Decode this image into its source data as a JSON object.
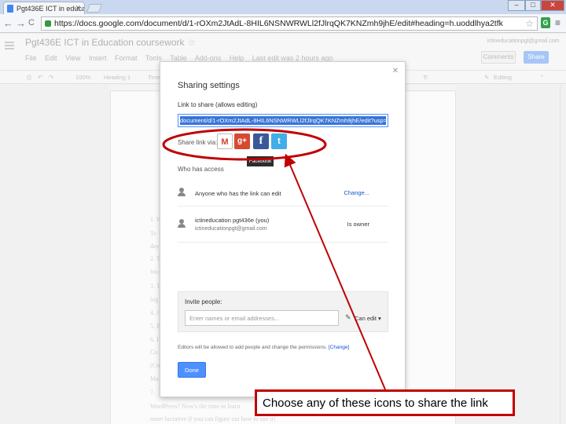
{
  "browser": {
    "tab_title": "Pgt436E ICT in education",
    "url": "https://docs.google.com/document/d/1-rOXm2JtAdL-8HIL6NSNWRWLl2fJlrqQK7KNZmh9jhE/edit#heading=h.uoddlhya2tfk",
    "win_min": "–",
    "win_max": "□",
    "win_close": "✕",
    "back": "←",
    "forward": "→",
    "reload": "C",
    "bookmark_star": "☆",
    "extension": "G",
    "menu": "≡"
  },
  "docs": {
    "title": "Pgt436E ICT in Education coursework",
    "menus": [
      "File",
      "Edit",
      "View",
      "Insert",
      "Format",
      "Tools",
      "Table",
      "Add-ons",
      "Help",
      "Last edit was 2 hours ago"
    ],
    "user_email": "ictineducationpgt@gmail.com",
    "comments_label": "Comments",
    "share_label": "Share",
    "format_bar": {
      "zoom": "100%",
      "style": "Heading 1",
      "font": "Times...",
      "mode": "Editing"
    },
    "background_lines": [
      "1. W",
      "Te",
      "day",
      "2. T",
      "Wo",
      "3. T",
      "big",
      "4. J",
      "5. B",
      "6. I",
      "Co",
      "(Cre",
      "Ma",
      "7.",
      "WordPress? Now's the time to learn",
      "more lucrative if you can figure out how to use it!"
    ]
  },
  "dialog": {
    "title": "Sharing settings",
    "close": "✕",
    "link_label": "Link to share (allows editing)",
    "link_value": "document/d/1-rOXm2JtAdL-8HIL6NSNWRWLl2fJlrqQK7KNZmh9jhE/edit?usp=sharing",
    "share_via_label": "Share link via:",
    "share_icons": [
      "gmail-icon",
      "google-plus-icon",
      "facebook-icon",
      "twitter-icon"
    ],
    "share_glyphs": {
      "gmail": "M",
      "gplus": "g+",
      "facebook": "f",
      "twitter": "t"
    },
    "tooltip": "Facebook",
    "who_label": "Who has access",
    "access": [
      {
        "main": "Anyone who has the link can edit",
        "right": "Change..."
      },
      {
        "main": "ictineducation pgt436e (you)",
        "sub": "ictineducationpgt@gmail.com",
        "right": "Is owner"
      }
    ],
    "invite_label": "Invite people:",
    "invite_placeholder": "Enter names or email addresses...",
    "permission": "Can edit ▾",
    "editors_note": "Editors will be allowed to add people and change the permissions.",
    "editors_change": "[Change]",
    "done_label": "Done"
  },
  "annotation": {
    "callout_text": "Choose any of these icons to share the link",
    "color": "#c00000"
  }
}
